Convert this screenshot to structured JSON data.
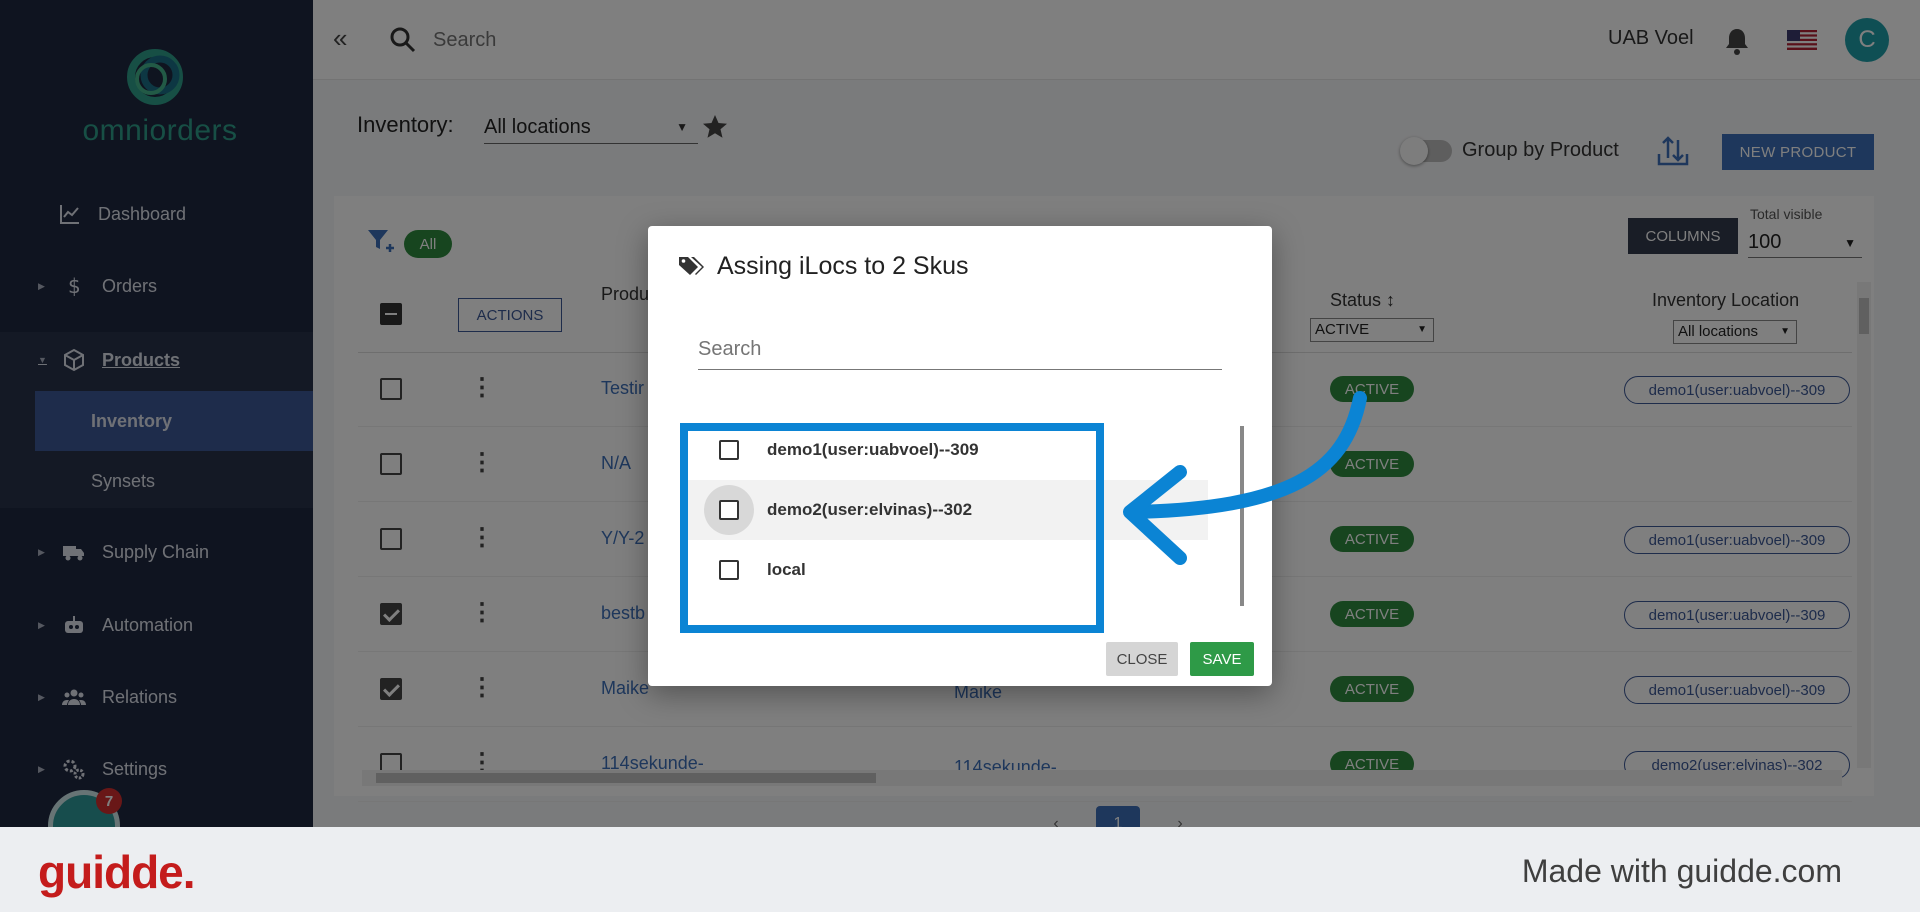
{
  "brand": {
    "name": "omniorders",
    "accent": "#2e9f8a"
  },
  "sidebar": {
    "items": [
      {
        "label": "Dashboard",
        "icon": "chart-line-icon"
      },
      {
        "label": "Orders",
        "icon": "dollar-icon"
      },
      {
        "label": "Products",
        "icon": "box-icon"
      },
      {
        "label": "Supply Chain",
        "icon": "truck-icon"
      },
      {
        "label": "Automation",
        "icon": "robot-icon"
      },
      {
        "label": "Relations",
        "icon": "users-icon"
      },
      {
        "label": "Settings",
        "icon": "gears-icon"
      }
    ],
    "products_sub": [
      {
        "label": "Inventory"
      },
      {
        "label": "Synsets"
      }
    ],
    "chat_badge": "7"
  },
  "topbar": {
    "search_placeholder": "Search",
    "company": "UAB Voel",
    "avatar_initial": "C"
  },
  "page": {
    "inventory_label": "Inventory:",
    "location_value": "All locations",
    "group_by_label": "Group by Product",
    "new_product_label": "NEW PRODUCT",
    "filter_chip": "All",
    "columns_label": "COLUMNS",
    "total_visible_label": "Total visible",
    "total_visible_value": "100"
  },
  "table": {
    "actions_label": "ACTIONS",
    "col_product": "Produ",
    "col_status": "Status",
    "status_filter": "ACTIVE",
    "col_location": "Inventory Location",
    "location_filter": "All locations",
    "rows": [
      {
        "name": "Testir",
        "name2": "",
        "status": "ACTIVE",
        "location": "demo1(user:uabvoel)--309",
        "checked": false
      },
      {
        "name": "N/A",
        "name2": "",
        "status": "ACTIVE",
        "location": "",
        "checked": false
      },
      {
        "name": "Y/Y-2",
        "name2": "",
        "status": "ACTIVE",
        "location": "demo1(user:uabvoel)--309",
        "checked": false
      },
      {
        "name": "bestb",
        "name2": "",
        "status": "ACTIVE",
        "location": "demo1(user:uabvoel)--309",
        "checked": true
      },
      {
        "name": "Maike",
        "name2": "Maike",
        "status": "ACTIVE",
        "location": "demo1(user:uabvoel)--309",
        "checked": true
      },
      {
        "name": "114sekunde-",
        "name2": "114sekunde-",
        "status": "ACTIVE",
        "location": "demo2(user:elvinas)--302",
        "checked": false
      }
    ],
    "current_page": "1"
  },
  "modal": {
    "title": "Assing iLocs to 2 Skus",
    "search_placeholder": "Search",
    "options": [
      {
        "label": "demo1(user:uabvoel)--309"
      },
      {
        "label": "demo2(user:elvinas)--302"
      },
      {
        "label": "local"
      }
    ],
    "close_label": "CLOSE",
    "save_label": "SAVE"
  },
  "footer": {
    "logo": "guidde.",
    "made_with": "Made with guidde.com"
  },
  "colors": {
    "highlight": "#0b84d4",
    "status_active": "#2e8b3e",
    "primary": "#3c6fb8",
    "sidebar_bg": "#1f2840"
  }
}
